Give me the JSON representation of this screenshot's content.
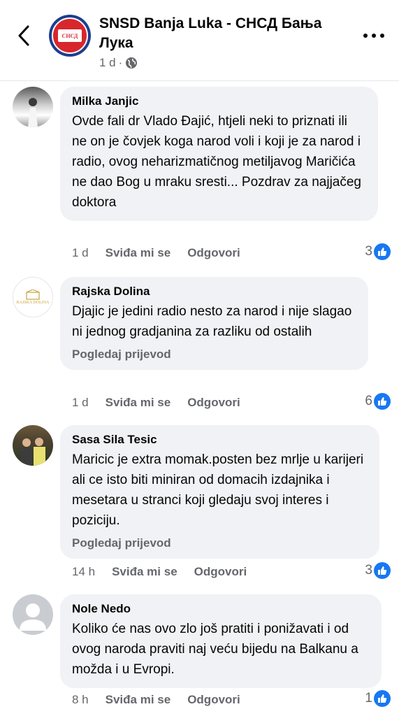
{
  "header": {
    "page_name": "SNSD Banja Luka - СНСД Бања Лука",
    "time": "1 d",
    "separator": "·",
    "logo_text": "СНСД"
  },
  "comments": [
    {
      "author": "Milka Janjic",
      "text": "Ovde fali dr Vlado Đajić, htjeli neki to priznati ili ne on je čovjek koga narod voli i koji je za narod i radio, ovog neharizmatičnog metiljavog Maričića ne dao Bog u mraku sresti... Pozdrav za najjačeg doktora",
      "translate": "",
      "time": "1 d",
      "like_label": "Sviđa mi se",
      "reply_label": "Odgovori",
      "reactions": "3"
    },
    {
      "author": "Rajska Dolina",
      "avatar_text": "RAJSKA DOLINA",
      "text": "Djajic je jedini radio nesto za narod i nije slagao ni jednog gradjanina za razliku od ostalih",
      "translate": "Pogledaj prijevod",
      "time": "1 d",
      "like_label": "Sviđa mi se",
      "reply_label": "Odgovori",
      "reactions": "6"
    },
    {
      "author": "Sasa Sila Tesic",
      "text": "Maricic je extra momak.posten bez mrlje u karijeri ali ce isto biti miniran od domacih izdajnika i mesetara u stranci koji gledaju svoj interes i poziciju.",
      "translate": "Pogledaj prijevod",
      "time": "14 h",
      "like_label": "Sviđa mi se",
      "reply_label": "Odgovori",
      "reactions": "3"
    },
    {
      "author": "Nole Nedo",
      "text": "Koliko će nas ovo zlo još pratiti i ponižavati i od ovog naroda praviti naj veću bijedu na Balkanu a možda i u Evropi.",
      "translate": "",
      "time": "8 h",
      "like_label": "Sviđa mi se",
      "reply_label": "Odgovori",
      "reactions": "1"
    }
  ],
  "colors": {
    "like_blue": "#1877f2",
    "bubble_bg": "#f0f2f5",
    "secondary_text": "#65676b"
  }
}
